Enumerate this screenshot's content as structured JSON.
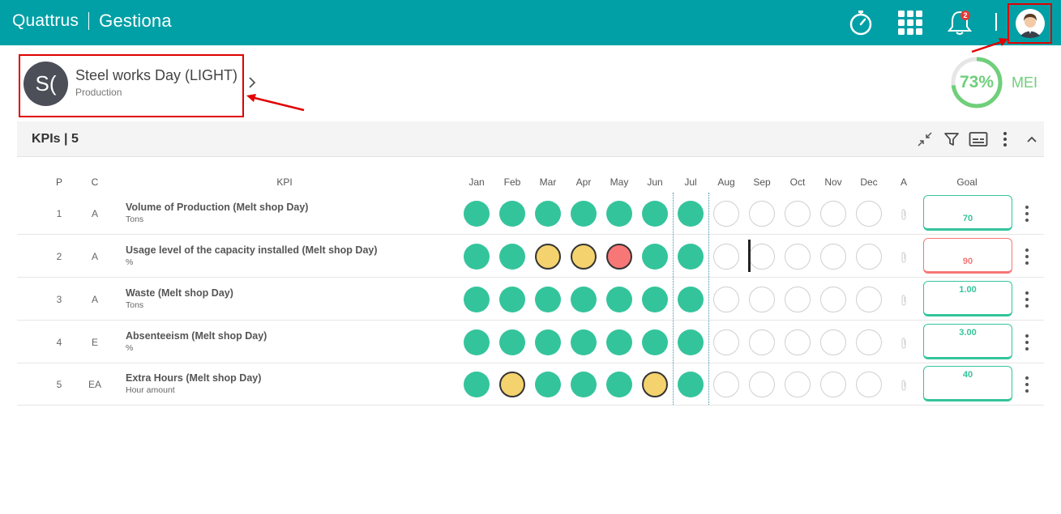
{
  "app": {
    "brand": "Quattrus",
    "module": "Gestiona"
  },
  "topbar": {
    "icons": [
      "stopwatch-icon",
      "apps-grid-icon",
      "bell-icon",
      "user-avatar-icon"
    ],
    "notification_count": "2"
  },
  "indicator": {
    "initials": "S(",
    "name": "Steel works Day (LIGHT)",
    "type": "Production"
  },
  "mei": {
    "percent": "73%",
    "value": 0.73,
    "label": "MEI",
    "color": "#6fcf7a"
  },
  "section": {
    "title": "KPIs | 5"
  },
  "table": {
    "headers": {
      "p": "P",
      "c": "C",
      "kpi": "KPI",
      "a": "A",
      "goal": "Goal"
    },
    "months": [
      "Jan",
      "Feb",
      "Mar",
      "Apr",
      "May",
      "Jun",
      "Jul",
      "Aug",
      "Sep",
      "Oct",
      "Nov",
      "Dec"
    ],
    "rows": [
      {
        "p": "1",
        "c": "A",
        "name": "Volume of Production (Melt shop Day)",
        "unit": "Tons",
        "status": [
          "green",
          "green",
          "green",
          "green",
          "green",
          "green",
          "green",
          "empty",
          "empty",
          "empty",
          "empty",
          "empty"
        ],
        "goal": "70",
        "goal_status": "green"
      },
      {
        "p": "2",
        "c": "A",
        "name": "Usage level of the capacity installed (Melt shop Day)",
        "unit": "%",
        "status": [
          "green",
          "green",
          "yellow",
          "yellow",
          "red",
          "green",
          "green",
          "empty",
          "empty",
          "empty",
          "empty",
          "empty"
        ],
        "goal": "90",
        "goal_status": "red"
      },
      {
        "p": "3",
        "c": "A",
        "name": "Waste (Melt shop Day)",
        "unit": "Tons",
        "status": [
          "green",
          "green",
          "green",
          "green",
          "green",
          "green",
          "green",
          "empty",
          "empty",
          "empty",
          "empty",
          "empty"
        ],
        "goal": "1.00",
        "goal_status": "green"
      },
      {
        "p": "4",
        "c": "E",
        "name": "Absenteeism (Melt shop Day)",
        "unit": "%",
        "status": [
          "green",
          "green",
          "green",
          "green",
          "green",
          "green",
          "green",
          "empty",
          "empty",
          "empty",
          "empty",
          "empty"
        ],
        "goal": "3.00",
        "goal_status": "green"
      },
      {
        "p": "5",
        "c": "EA",
        "name": "Extra Hours (Melt shop Day)",
        "unit": "Hour amount",
        "status": [
          "green",
          "yellow",
          "green",
          "green",
          "green",
          "yellow",
          "green",
          "empty",
          "empty",
          "empty",
          "empty",
          "empty"
        ],
        "goal": "40",
        "goal_status": "green"
      }
    ]
  },
  "colors": {
    "topbar": "#00a0a6",
    "green": "#34c49c",
    "yellow": "#f4d26d",
    "red": "#f77676",
    "highlight": "#e00000"
  }
}
